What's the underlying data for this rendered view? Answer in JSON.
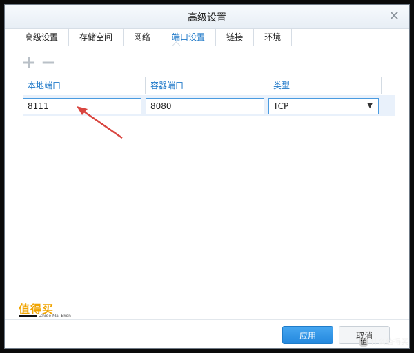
{
  "dialog": {
    "title": "高级设置",
    "close_icon": "close-icon"
  },
  "tabs": [
    {
      "label": "高级设置"
    },
    {
      "label": "存储空间"
    },
    {
      "label": "网络"
    },
    {
      "label": "端口设置",
      "active": true
    },
    {
      "label": "链接"
    },
    {
      "label": "环境"
    }
  ],
  "toolbar": {
    "add_symbol": "+",
    "remove_symbol": "−"
  },
  "table": {
    "columns": [
      "本地端口",
      "容器端口",
      "类型"
    ],
    "rows": [
      {
        "local_port": "8111",
        "container_port": "8080",
        "type": "TCP"
      }
    ]
  },
  "logo": {
    "text": "值得买",
    "sub": "Zhide Mai Ekon"
  },
  "buttons": {
    "apply": "应用",
    "cancel": "取消"
  },
  "watermark": {
    "text": "什么值得买",
    "badge": "值"
  },
  "colors": {
    "accent": "#1e78c8",
    "primary_button": "#2488de",
    "annotation_arrow": "#d9453f"
  }
}
